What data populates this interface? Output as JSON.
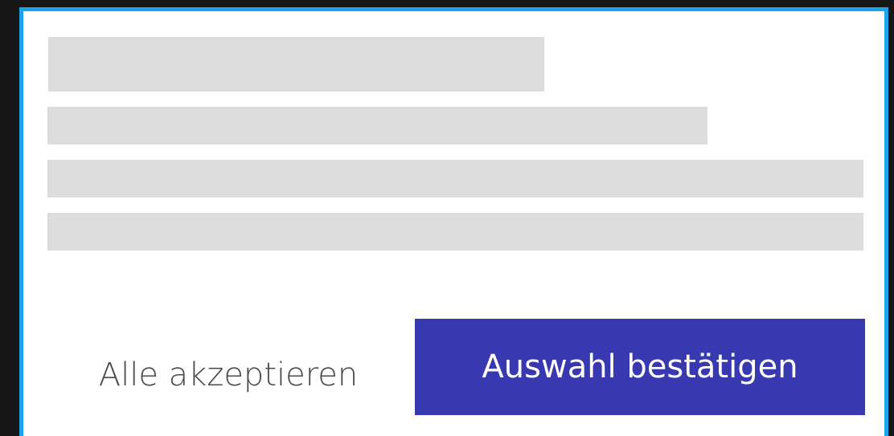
{
  "colors": {
    "background": "#161616",
    "dialog_border": "#1aa3ea",
    "dialog_background": "#ffffff",
    "skeleton": "#dddddd",
    "primary_button": "#3838b0",
    "secondary_text": "#4a4a4a"
  },
  "dialog": {
    "skeleton_lines": 4,
    "actions": {
      "accept_all_label": "Alle akzeptieren",
      "confirm_selection_label": "Auswahl bestätigen"
    }
  }
}
